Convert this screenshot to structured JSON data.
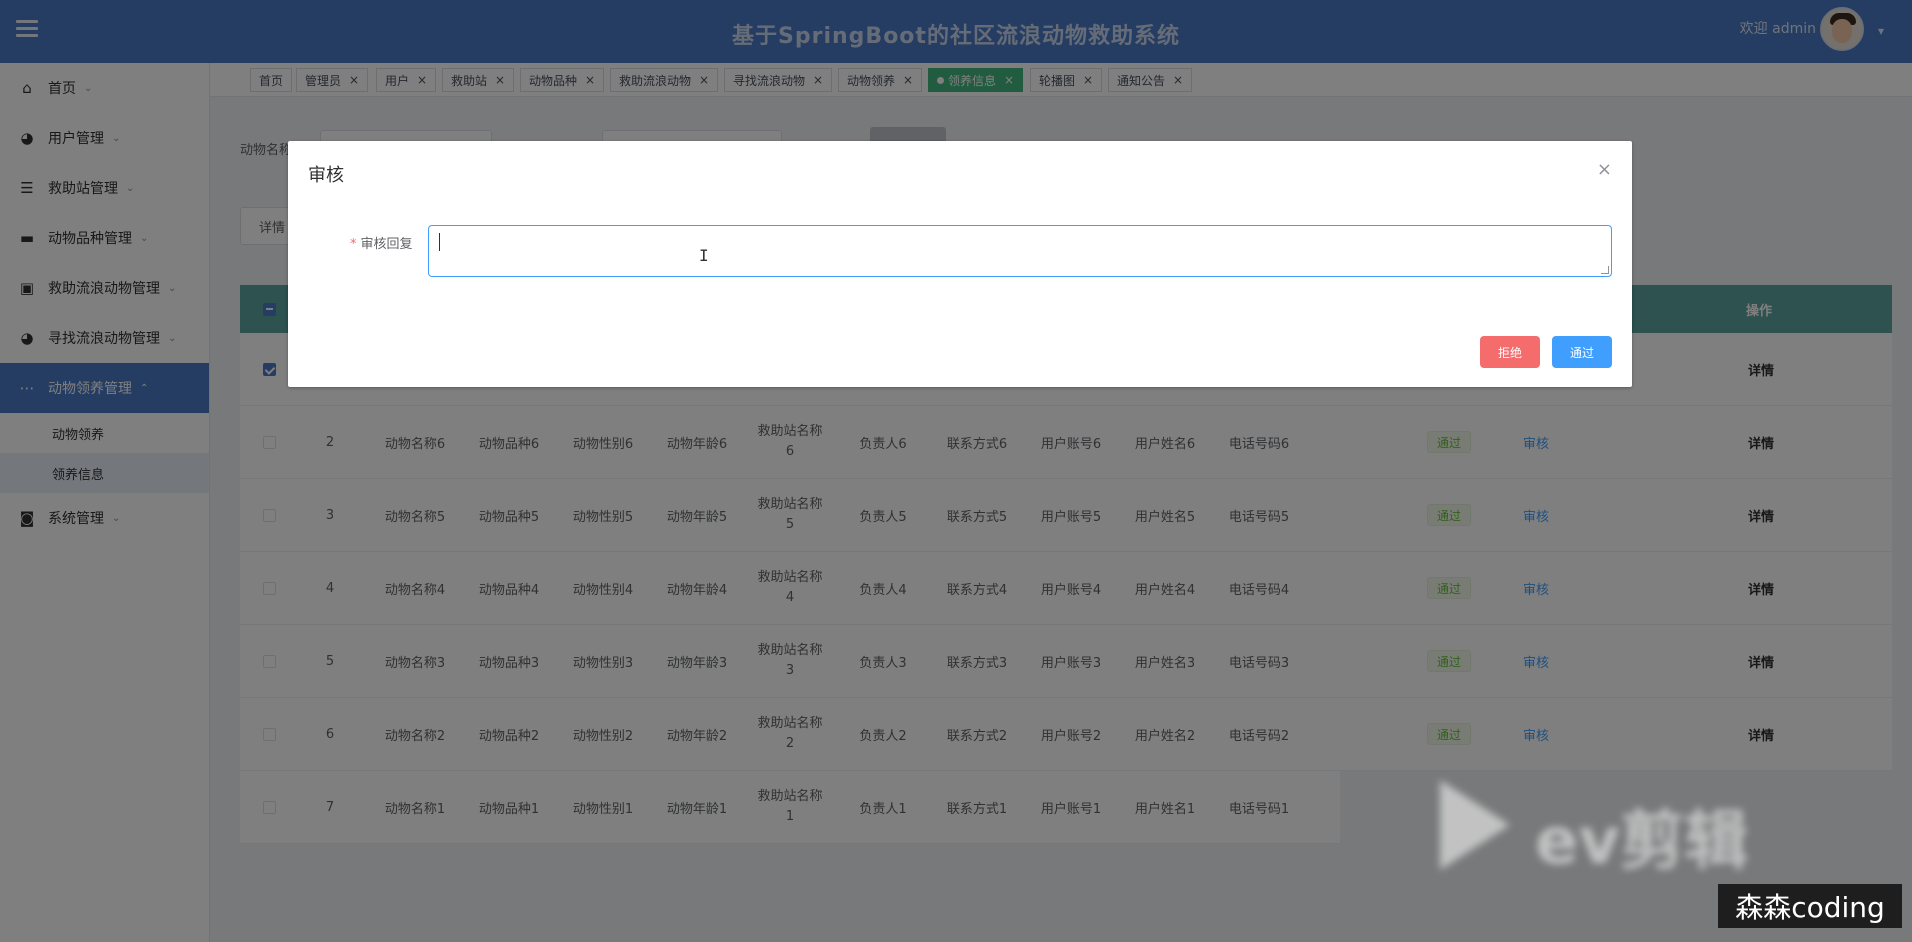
{
  "header": {
    "title": "基于SpringBoot的社区流浪动物救助系统",
    "welcome": "欢迎 admin"
  },
  "sidebar": {
    "items": [
      {
        "label": "首页",
        "icon": "home-icon"
      },
      {
        "label": "用户管理",
        "icon": "gauge-icon"
      },
      {
        "label": "救助站管理",
        "icon": "storage-icon"
      },
      {
        "label": "动物品种管理",
        "icon": "monitor-icon"
      },
      {
        "label": "救助流浪动物管理",
        "icon": "briefcase-icon"
      },
      {
        "label": "寻找流浪动物管理",
        "icon": "gauge-icon"
      },
      {
        "label": "动物领养管理",
        "icon": "more-icon"
      },
      {
        "label": "系统管理",
        "icon": "people-icon"
      }
    ],
    "sub_items": [
      {
        "label": "动物领养"
      },
      {
        "label": "领养信息"
      }
    ]
  },
  "tabs": [
    {
      "label": "首页",
      "closable": false
    },
    {
      "label": "管理员",
      "closable": true
    },
    {
      "label": "用户",
      "closable": true
    },
    {
      "label": "救助站",
      "closable": true
    },
    {
      "label": "动物品种",
      "closable": true
    },
    {
      "label": "救助流浪动物",
      "closable": true
    },
    {
      "label": "寻找流浪动物",
      "closable": true
    },
    {
      "label": "动物领养",
      "closable": true
    },
    {
      "label": "领养信息",
      "closable": true,
      "active": true
    },
    {
      "label": "轮播图",
      "closable": true
    },
    {
      "label": "通知公告",
      "closable": true
    }
  ],
  "search": {
    "label": "动物名称"
  },
  "toolbar": {
    "detail_label": "详情"
  },
  "table": {
    "op_header": "操作",
    "rows": [
      {
        "idx": "",
        "c1": "",
        "c2": "",
        "c3": "",
        "c4": "",
        "c5a": "",
        "c5b": "",
        "c6": "",
        "c7": "",
        "c8": "",
        "c9": "",
        "c10": "",
        "status": "",
        "audit": "",
        "detail": "详情",
        "checked": true
      },
      {
        "idx": "2",
        "c1": "动物名称6",
        "c2": "动物品种6",
        "c3": "动物性别6",
        "c4": "动物年龄6",
        "c5a": "救助站名称",
        "c5b": "6",
        "c6": "负责人6",
        "c7": "联系方式6",
        "c8": "用户账号6",
        "c9": "用户姓名6",
        "c10": "电话号码6",
        "status": "通过",
        "audit": "审核",
        "detail": "详情"
      },
      {
        "idx": "3",
        "c1": "动物名称5",
        "c2": "动物品种5",
        "c3": "动物性别5",
        "c4": "动物年龄5",
        "c5a": "救助站名称",
        "c5b": "5",
        "c6": "负责人5",
        "c7": "联系方式5",
        "c8": "用户账号5",
        "c9": "用户姓名5",
        "c10": "电话号码5",
        "status": "通过",
        "audit": "审核",
        "detail": "详情"
      },
      {
        "idx": "4",
        "c1": "动物名称4",
        "c2": "动物品种4",
        "c3": "动物性别4",
        "c4": "动物年龄4",
        "c5a": "救助站名称",
        "c5b": "4",
        "c6": "负责人4",
        "c7": "联系方式4",
        "c8": "用户账号4",
        "c9": "用户姓名4",
        "c10": "电话号码4",
        "status": "通过",
        "audit": "审核",
        "detail": "详情"
      },
      {
        "idx": "5",
        "c1": "动物名称3",
        "c2": "动物品种3",
        "c3": "动物性别3",
        "c4": "动物年龄3",
        "c5a": "救助站名称",
        "c5b": "3",
        "c6": "负责人3",
        "c7": "联系方式3",
        "c8": "用户账号3",
        "c9": "用户姓名3",
        "c10": "电话号码3",
        "status": "通过",
        "audit": "审核",
        "detail": "详情"
      },
      {
        "idx": "6",
        "c1": "动物名称2",
        "c2": "动物品种2",
        "c3": "动物性别2",
        "c4": "动物年龄2",
        "c5a": "救助站名称",
        "c5b": "2",
        "c6": "负责人2",
        "c7": "联系方式2",
        "c8": "用户账号2",
        "c9": "用户姓名2",
        "c10": "电话号码2",
        "status": "通过",
        "audit": "审核",
        "detail": "详情"
      },
      {
        "idx": "7",
        "c1": "动物名称1",
        "c2": "动物品种1",
        "c3": "动物性别1",
        "c4": "动物年龄1",
        "c5a": "救助站名称",
        "c5b": "1",
        "c6": "负责人1",
        "c7": "联系方式1",
        "c8": "用户账号1",
        "c9": "用户姓名1",
        "c10": "电话号码1",
        "status": "",
        "audit": "",
        "detail": ""
      }
    ]
  },
  "dialog": {
    "title": "审核",
    "close": "×",
    "field_required": "*",
    "field_label": "审核回复",
    "field_value": "",
    "reject_label": "拒绝",
    "pass_label": "通过"
  },
  "watermark": {
    "logo_text": "ev剪辑",
    "label": "森森coding"
  }
}
